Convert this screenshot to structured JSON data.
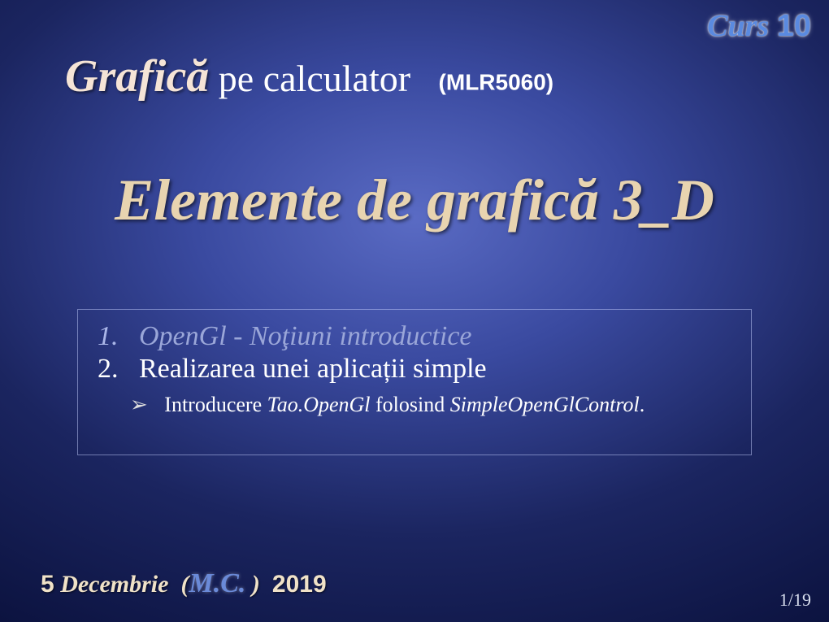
{
  "course_tag": {
    "label": "Curs",
    "number": "10"
  },
  "subtitle": {
    "strong": "Grafică",
    "light": "pe calculator",
    "code": "(MLR5060)"
  },
  "main_title": "Elemente de grafică 3_D",
  "content": {
    "item1_num": "1.",
    "item1_text": "OpenGl - Noţiuni introductice",
    "item2_num": "2.",
    "item2_text": "Realizarea unei aplicații simple",
    "sub_arrow": "➢",
    "sub_pre": "Introducere ",
    "sub_ital1": "Tao.OpenGl",
    "sub_mid": " folosind ",
    "sub_ital2": "SimpleOpenGlControl",
    "sub_end": "."
  },
  "footer": {
    "day": "5",
    "month": "Decembrie",
    "paren_open": "(",
    "mc": "M.C.",
    "paren_close": ")",
    "year": "2019"
  },
  "page": {
    "current": "1",
    "sep": "/",
    "total": "19"
  }
}
